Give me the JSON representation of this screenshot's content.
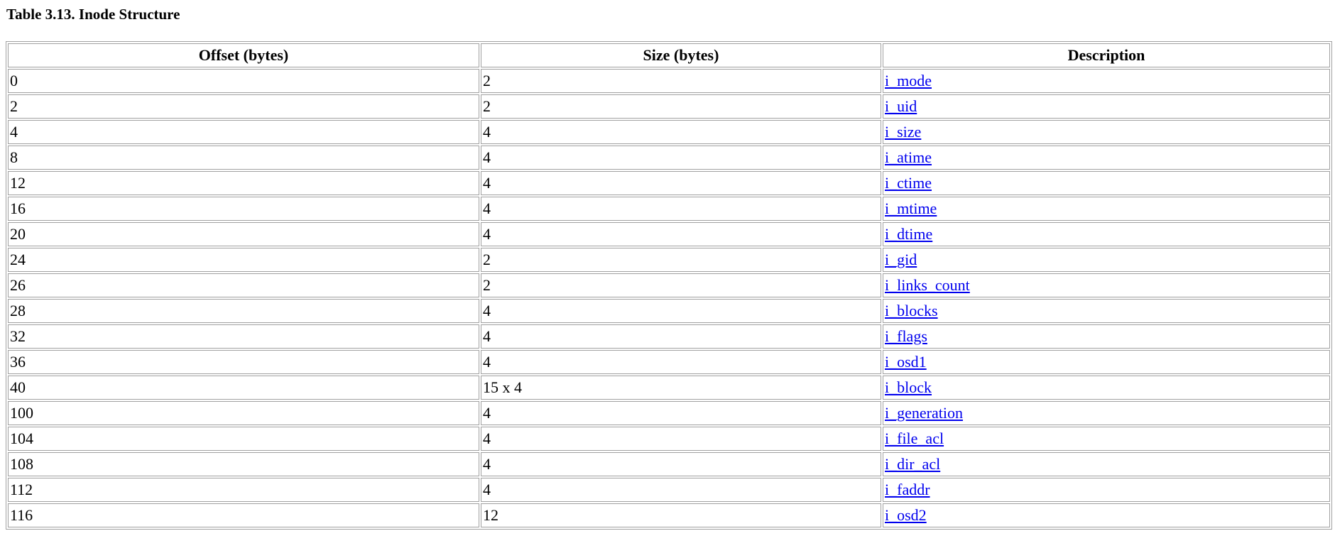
{
  "caption": "Table 3.13. Inode Structure",
  "table": {
    "headers": [
      "Offset (bytes)",
      "Size (bytes)",
      "Description"
    ],
    "rows": [
      {
        "offset": "0",
        "size": "2",
        "description": "i_mode"
      },
      {
        "offset": "2",
        "size": "2",
        "description": "i_uid"
      },
      {
        "offset": "4",
        "size": "4",
        "description": "i_size"
      },
      {
        "offset": "8",
        "size": "4",
        "description": "i_atime"
      },
      {
        "offset": "12",
        "size": "4",
        "description": "i_ctime"
      },
      {
        "offset": "16",
        "size": "4",
        "description": "i_mtime"
      },
      {
        "offset": "20",
        "size": "4",
        "description": "i_dtime"
      },
      {
        "offset": "24",
        "size": "2",
        "description": "i_gid"
      },
      {
        "offset": "26",
        "size": "2",
        "description": "i_links_count"
      },
      {
        "offset": "28",
        "size": "4",
        "description": "i_blocks"
      },
      {
        "offset": "32",
        "size": "4",
        "description": "i_flags"
      },
      {
        "offset": "36",
        "size": "4",
        "description": "i_osd1"
      },
      {
        "offset": "40",
        "size": "15 x 4",
        "description": "i_block"
      },
      {
        "offset": "100",
        "size": "4",
        "description": "i_generation"
      },
      {
        "offset": "104",
        "size": "4",
        "description": "i_file_acl"
      },
      {
        "offset": "108",
        "size": "4",
        "description": "i_dir_acl"
      },
      {
        "offset": "112",
        "size": "4",
        "description": "i_faddr"
      },
      {
        "offset": "116",
        "size": "12",
        "description": "i_osd2"
      }
    ]
  },
  "colors": {
    "link": "#0000ee",
    "border": "#a0a0a0",
    "text": "#000000",
    "background": "#ffffff"
  }
}
